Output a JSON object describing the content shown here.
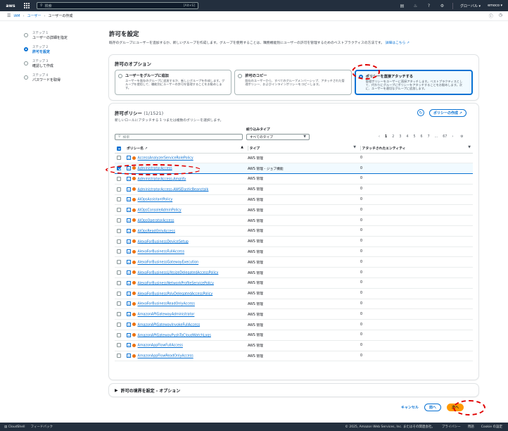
{
  "topnav": {
    "logo": "aws",
    "search_placeholder": "検索",
    "search_shortcut": "[Alt+S]",
    "region": "グローバル",
    "account": "emoco"
  },
  "breadcrumb": [
    "IAM",
    "ユーザー",
    "ユーザーの作成"
  ],
  "steps": [
    {
      "num": "ステップ 1",
      "label": "ユーザーの詳細を指定"
    },
    {
      "num": "ステップ 2",
      "label": "許可を設定"
    },
    {
      "num": "ステップ 3",
      "label": "確認して作成"
    },
    {
      "num": "ステップ 4",
      "label": "パスワードを取得"
    }
  ],
  "page": {
    "title": "許可を設定",
    "description": "既存のグループにユーザーを追加するか、新しいグループを作成します。グループを使用することは、職務機能別にユーザーの許可を管理するためのベストプラクティスの方法です。",
    "learn_more": "詳細はこちら"
  },
  "options": {
    "title": "許可のオプション",
    "items": [
      {
        "title": "ユーザーをグループに追加",
        "desc": "ユーザーを既存のグループに追加するか、新しいグループを作成します。グループを使用して、職能別にユーザーの許可を管理することをお勧めします。"
      },
      {
        "title": "許可のコピー",
        "desc": "既存のユーザーから、すべてのグループメンバーシップ、アタッチされた管理ポリシー、およびインラインポリシーをコピーします。"
      },
      {
        "title": "ポリシーを直接アタッチする",
        "desc": "管理ポリシーをユーザーに直接アタッチします。ベストプラクティスとして、代わりにグループにポリシーをアタッチすることをお勧めします。次に、ユーザーを適切なグループに追加します。"
      }
    ]
  },
  "policies": {
    "title": "許可ポリシー",
    "count": "(1/1521)",
    "subtitle": "新しいロールにアタッチする 1 つまたは複数のポリシーを選択します。",
    "create_button": "ポリシーの作成",
    "filter_label": "絞り込みタイプ",
    "search_placeholder": "検索",
    "filter_value": "すべてのタイプ",
    "pages": [
      "1",
      "2",
      "3",
      "4",
      "5",
      "6",
      "7",
      "...",
      "67"
    ],
    "columns": [
      "ポリシー名",
      "タイプ",
      "アタッチされたエンティティ"
    ],
    "rows": [
      {
        "name": "AccessAnalyzerServiceRolePolicy",
        "type": "AWS 管理",
        "entities": "0",
        "checked": false
      },
      {
        "name": "AdministratorAccess",
        "type": "AWS 管理 - ジョブ機能",
        "entities": "0",
        "checked": true
      },
      {
        "name": "AdministratorAccess-Amplify",
        "type": "AWS 管理",
        "entities": "0",
        "checked": false
      },
      {
        "name": "AdministratorAccess-AWSElasticBeanstalk",
        "type": "AWS 管理",
        "entities": "0",
        "checked": false
      },
      {
        "name": "AIOpsAssistantPolicy",
        "type": "AWS 管理",
        "entities": "0",
        "checked": false
      },
      {
        "name": "AIOpsConsoleAdminPolicy",
        "type": "AWS 管理",
        "entities": "0",
        "checked": false
      },
      {
        "name": "AIOpsOperatorAccess",
        "type": "AWS 管理",
        "entities": "0",
        "checked": false
      },
      {
        "name": "AIOpsReadOnlyAccess",
        "type": "AWS 管理",
        "entities": "0",
        "checked": false
      },
      {
        "name": "AlexaForBusinessDeviceSetup",
        "type": "AWS 管理",
        "entities": "0",
        "checked": false
      },
      {
        "name": "AlexaForBusinessFullAccess",
        "type": "AWS 管理",
        "entities": "0",
        "checked": false
      },
      {
        "name": "AlexaForBusinessGatewayExecution",
        "type": "AWS 管理",
        "entities": "0",
        "checked": false
      },
      {
        "name": "AlexaForBusinessLifesizeDelegatedAccessPolicy",
        "type": "AWS 管理",
        "entities": "0",
        "checked": false
      },
      {
        "name": "AlexaForBusinessNetworkProfileServicePolicy",
        "type": "AWS 管理",
        "entities": "0",
        "checked": false
      },
      {
        "name": "AlexaForBusinessPolyDelegatedAccessPolicy",
        "type": "AWS 管理",
        "entities": "0",
        "checked": false
      },
      {
        "name": "AlexaForBusinessReadOnlyAccess",
        "type": "AWS 管理",
        "entities": "0",
        "checked": false
      },
      {
        "name": "AmazonAPIGatewayAdministrator",
        "type": "AWS 管理",
        "entities": "0",
        "checked": false
      },
      {
        "name": "AmazonAPIGatewayInvokeFullAccess",
        "type": "AWS 管理",
        "entities": "0",
        "checked": false
      },
      {
        "name": "AmazonAPIGatewayPushToCloudWatchLogs",
        "type": "AWS 管理",
        "entities": "0",
        "checked": false
      },
      {
        "name": "AmazonAppFlowFullAccess",
        "type": "AWS 管理",
        "entities": "0",
        "checked": false
      },
      {
        "name": "AmazonAppFlowReadOnlyAccess",
        "type": "AWS 管理",
        "entities": "0",
        "checked": false
      }
    ]
  },
  "boundary": {
    "title": "許可の境界を設定 - オプション"
  },
  "actions": {
    "cancel": "キャンセル",
    "back": "前へ",
    "next": "次へ"
  },
  "footer": {
    "cloudshell": "CloudShell",
    "feedback": "フィードバック",
    "copyright": "© 2025, Amazon Web Services, Inc. またはその関連会社。",
    "privacy": "プライバシー",
    "terms": "用語",
    "cookies": "Cookie の設定"
  },
  "colors": {
    "accent": "#0972d3",
    "primary_button": "#ff9900",
    "nav": "#232f3e",
    "highlight": "#e00000"
  }
}
